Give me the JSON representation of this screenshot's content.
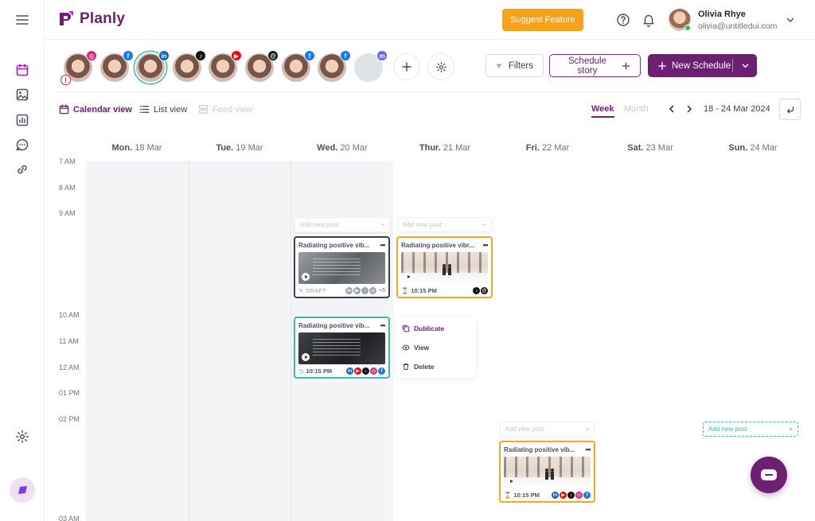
{
  "app": {
    "name": "Planly"
  },
  "header": {
    "suggest_label": "Suggest Feature",
    "user_name": "Olivia Rhye",
    "user_email": "olivia@untitledui.com"
  },
  "accounts": [
    {
      "network": "instagram",
      "color": "#d62976",
      "glyph": "◎",
      "warning": "!"
    },
    {
      "network": "facebook",
      "color": "#1877f2",
      "glyph": "f"
    },
    {
      "network": "linkedin",
      "color": "#0a66c2",
      "glyph": "in",
      "selected": true
    },
    {
      "network": "tiktok",
      "color": "#111111",
      "glyph": "♪"
    },
    {
      "network": "youtube",
      "color": "#ff0000",
      "glyph": "▶"
    },
    {
      "network": "threads",
      "color": "#111111",
      "glyph": "@"
    },
    {
      "network": "facebook",
      "color": "#1877f2",
      "glyph": "f"
    },
    {
      "network": "facebook",
      "color": "#1877f2",
      "glyph": "f"
    },
    {
      "network": "mastodon",
      "color": "#6364ff",
      "glyph": "m",
      "blank": true
    }
  ],
  "toolbar": {
    "filters_label": "Filters",
    "schedule_story_label": "Schedule story",
    "new_schedule_label": "New Schedule"
  },
  "views": {
    "calendar": "Calendar view",
    "list": "List view",
    "feed": "Feed view"
  },
  "range": {
    "week": "Week",
    "month": "Month",
    "dates": "18 - 24 Mar 2024"
  },
  "days": [
    {
      "name": "Mon.",
      "date": "18 Mar"
    },
    {
      "name": "Tue.",
      "date": "19 Mar"
    },
    {
      "name": "Wed.",
      "date": "20 Mar"
    },
    {
      "name": "Thur.",
      "date": "21 Mar"
    },
    {
      "name": "Fri.",
      "date": "22 Mar"
    },
    {
      "name": "Sat.",
      "date": "23 Mar"
    },
    {
      "name": "Sun.",
      "date": "24 Mar"
    }
  ],
  "times": [
    "7 AM",
    "8 AM",
    "9 AM",
    "10 AM",
    "11 AM",
    "12 AM",
    "01 PM",
    "02 PM",
    "03 AM"
  ],
  "add_post_label": "Add new post",
  "posts": [
    {
      "title": "Radiating positive vib...",
      "status": "DRAFT",
      "extra": "+5",
      "border": "#3a3f4b"
    },
    {
      "title": "Radiating positive vibr...",
      "time": "10:15 PM",
      "border": "#f5a623"
    },
    {
      "title": "Radiating positive vib...",
      "time": "10:15 PM",
      "border": "#3fb9a2"
    },
    {
      "title": "Radiating positive vib...",
      "time": "10:15 PM",
      "border": "#f5a623"
    }
  ],
  "context_menu": {
    "duplicate": "Dublicate",
    "view": "View",
    "delete": "Delete"
  },
  "colors": {
    "brand": "#6d1f72",
    "accent": "#f7a21b",
    "teal": "#3fb9a2"
  }
}
